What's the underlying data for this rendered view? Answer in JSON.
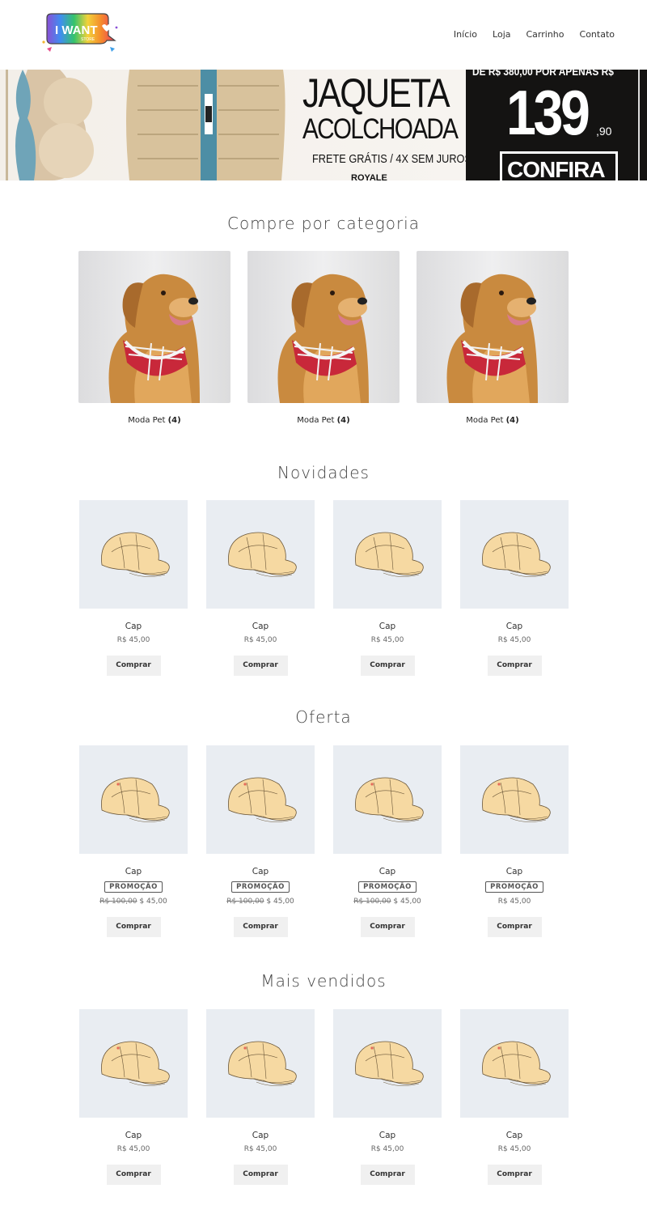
{
  "header": {
    "logo_text": "I WANT",
    "logo_sub": "STORE",
    "nav": [
      "Início",
      "Loja",
      "Carrinho",
      "Contato"
    ]
  },
  "banner": {
    "from_text": "DE R$ 380,00 POR APENAS R$",
    "title1": "JAQUETA",
    "title2": "ACOLCHOADA",
    "subtitle": "FRETE GRÁTIS / 4X SEM JUROS",
    "brand": "ROYALE",
    "price": "139",
    "cents": ",90",
    "cta": "CONFIRA"
  },
  "categories": {
    "title": "Compre por categoria",
    "items": [
      {
        "name": "Moda Pet",
        "count": "(4)"
      },
      {
        "name": "Moda Pet",
        "count": "(4)"
      },
      {
        "name": "Moda Pet",
        "count": "(4)"
      }
    ]
  },
  "novidades": {
    "title": "Novidades",
    "items": [
      {
        "name": "Cap",
        "price": "R$ 45,00",
        "buy": "Comprar"
      },
      {
        "name": "Cap",
        "price": "R$ 45,00",
        "buy": "Comprar"
      },
      {
        "name": "Cap",
        "price": "R$ 45,00",
        "buy": "Comprar"
      },
      {
        "name": "Cap",
        "price": "R$ 45,00",
        "buy": "Comprar"
      }
    ]
  },
  "oferta": {
    "title": "Oferta",
    "items": [
      {
        "name": "Cap",
        "badge": "PROMOÇÃO",
        "old_price": "R$ 100,00",
        "price": "$ 45,00",
        "buy": "Comprar"
      },
      {
        "name": "Cap",
        "badge": "PROMOÇÃO",
        "old_price": "R$ 100,00",
        "price": "$ 45,00",
        "buy": "Comprar"
      },
      {
        "name": "Cap",
        "badge": "PROMOÇÃO",
        "old_price": "R$ 100,00",
        "price": "$ 45,00",
        "buy": "Comprar"
      },
      {
        "name": "Cap",
        "badge": "PROMOÇÃO",
        "old_price": "",
        "price": "R$ 45,00",
        "buy": "Comprar"
      }
    ]
  },
  "mais_vendidos": {
    "title": "Mais vendidos",
    "items": [
      {
        "name": "Cap",
        "price": "R$ 45,00",
        "buy": "Comprar"
      },
      {
        "name": "Cap",
        "price": "R$ 45,00",
        "buy": "Comprar"
      },
      {
        "name": "Cap",
        "price": "R$ 45,00",
        "buy": "Comprar"
      },
      {
        "name": "Cap",
        "price": "R$ 45,00",
        "buy": "Comprar"
      }
    ]
  }
}
